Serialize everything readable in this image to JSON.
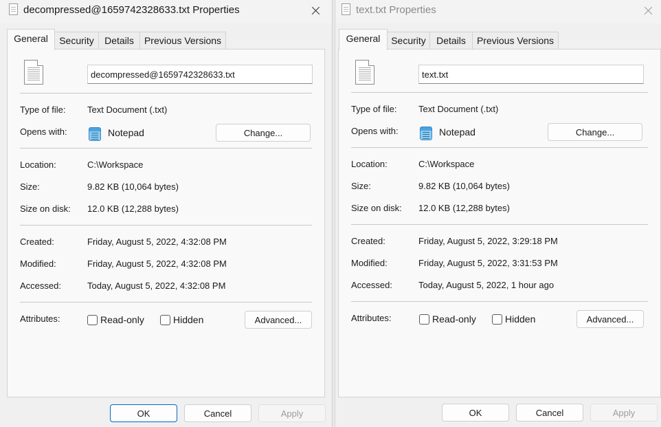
{
  "dialogs": [
    {
      "title": "decompressed@1659742328633.txt Properties",
      "tabs": [
        "General",
        "Security",
        "Details",
        "Previous Versions"
      ],
      "file_name": "decompressed@1659742328633.txt",
      "labels": {
        "type": "Type of file:",
        "opens": "Opens with:",
        "location": "Location:",
        "size": "Size:",
        "size_on_disk": "Size on disk:",
        "created": "Created:",
        "modified": "Modified:",
        "accessed": "Accessed:",
        "attributes": "Attributes:"
      },
      "type_of_file": "Text Document (.txt)",
      "opens_with": "Notepad",
      "change_button": "Change...",
      "location": "C:\\Workspace",
      "size": "9.82 KB (10,064 bytes)",
      "size_on_disk": "12.0 KB (12,288 bytes)",
      "created": "Friday, August 5, 2022, 4:32:08 PM",
      "modified": "Friday, August 5, 2022, 4:32:08 PM",
      "accessed": "Today, August 5, 2022, 4:32:08 PM",
      "readonly_label": "Read-only",
      "hidden_label": "Hidden",
      "advanced_button": "Advanced...",
      "ok_button": "OK",
      "cancel_button": "Cancel",
      "apply_button": "Apply",
      "icons": {
        "title": "text-file-icon",
        "file": "text-file-icon",
        "app": "notepad-icon",
        "close": "close-icon"
      }
    },
    {
      "title": "text.txt Properties",
      "tabs": [
        "General",
        "Security",
        "Details",
        "Previous Versions"
      ],
      "file_name": "text.txt",
      "labels": {
        "type": "Type of file:",
        "opens": "Opens with:",
        "location": "Location:",
        "size": "Size:",
        "size_on_disk": "Size on disk:",
        "created": "Created:",
        "modified": "Modified:",
        "accessed": "Accessed:",
        "attributes": "Attributes:"
      },
      "type_of_file": "Text Document (.txt)",
      "opens_with": "Notepad",
      "change_button": "Change...",
      "location": "C:\\Workspace",
      "size": "9.82 KB (10,064 bytes)",
      "size_on_disk": "12.0 KB (12,288 bytes)",
      "created": "Friday, August 5, 2022, 3:29:18 PM",
      "modified": "Friday, August 5, 2022, 3:31:53 PM",
      "accessed": "Today, August 5, 2022, 1 hour ago",
      "readonly_label": "Read-only",
      "hidden_label": "Hidden",
      "advanced_button": "Advanced...",
      "ok_button": "OK",
      "cancel_button": "Cancel",
      "apply_button": "Apply",
      "icons": {
        "title": "text-file-icon",
        "file": "text-file-icon",
        "app": "notepad-icon",
        "close": "close-icon"
      }
    }
  ]
}
